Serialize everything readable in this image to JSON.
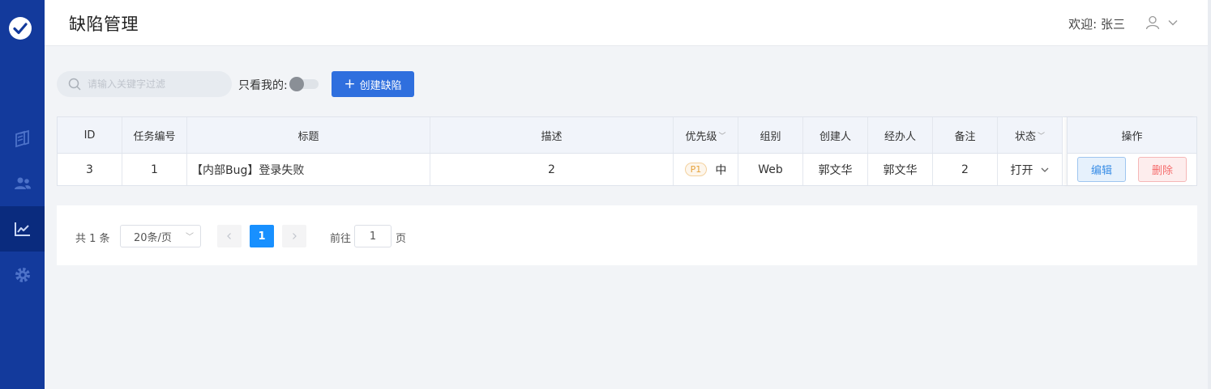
{
  "header": {
    "title": "缺陷管理",
    "welcome": "欢迎: 张三"
  },
  "toolbar": {
    "search_placeholder": "请输入关键字过滤",
    "only_mine_label": "只看我的:",
    "only_mine_on": false,
    "create_label": "创建缺陷"
  },
  "table": {
    "columns": {
      "id": "ID",
      "task_no": "任务编号",
      "title": "标题",
      "desc": "描述",
      "priority": "优先级",
      "group": "组别",
      "creator": "创建人",
      "assignee": "经办人",
      "remark": "备注",
      "status": "状态",
      "action": "操作"
    },
    "rows": [
      {
        "id": "3",
        "task_no": "1",
        "title": "【内部Bug】登录失败",
        "desc": "2",
        "priority_badge": "P1",
        "priority": "中",
        "group": "Web",
        "creator": "郭文华",
        "assignee": "郭文华",
        "remark": "2",
        "status": "打开",
        "edit_label": "编辑",
        "delete_label": "删除"
      }
    ]
  },
  "pagination": {
    "total": "共 1 条",
    "page_size": "20条/页",
    "current_page": "1",
    "goto_label": "前往",
    "goto_value": "1",
    "page_suffix": "页"
  },
  "colors": {
    "sidebar": "#133a9c",
    "primary": "#2f6fde",
    "danger": "#f56c6c"
  }
}
